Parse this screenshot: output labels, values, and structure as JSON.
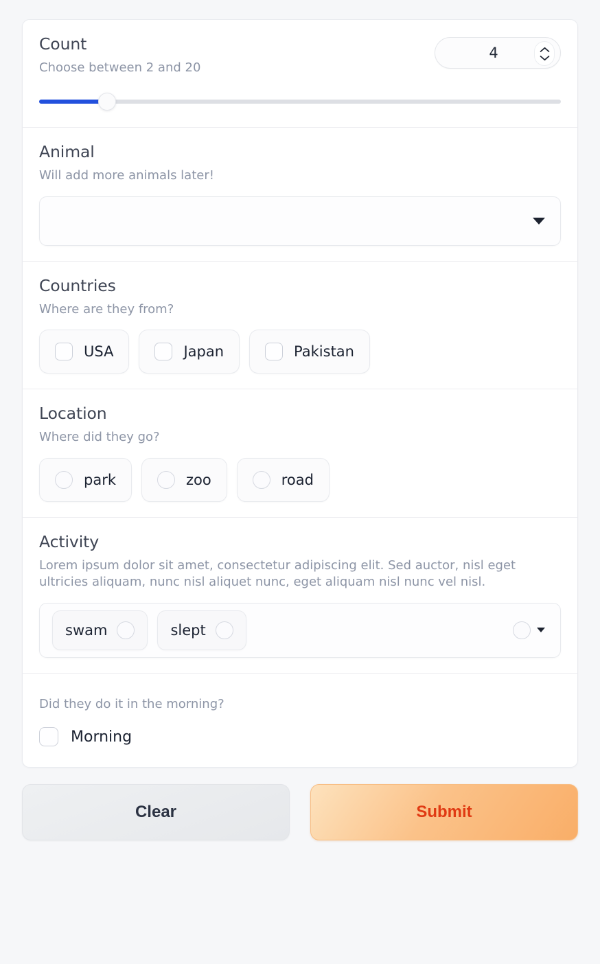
{
  "theme": {
    "page_bg": "#f6f7f9",
    "card_bg": "#ffffff",
    "divider": "#ececf0",
    "title_color": "#3f4554",
    "desc_color": "#8d95a6",
    "slider_fill": "#2250dd",
    "slider_track": "#dddfe4",
    "submit_text": "#e03a13",
    "submit_gradient_from": "#fde2bd",
    "submit_gradient_to": "#f9ae68",
    "clear_text": "#2b3242"
  },
  "count": {
    "title": "Count",
    "description": "Choose between 2 and 20",
    "value": "4",
    "min": 2,
    "max": 20,
    "slider_percent": 13,
    "increment_icon": "chevron-up-icon",
    "decrement_icon": "chevron-down-icon"
  },
  "animal": {
    "title": "Animal",
    "description": "Will add more animals later!",
    "selected": "",
    "placeholder": "",
    "dropdown_icon": "triangle-down-icon"
  },
  "countries": {
    "title": "Countries",
    "description": "Where are they from?",
    "options": [
      {
        "label": "USA",
        "checked": false
      },
      {
        "label": "Japan",
        "checked": false
      },
      {
        "label": "Pakistan",
        "checked": false
      }
    ]
  },
  "location": {
    "title": "Location",
    "description": "Where did they go?",
    "options": [
      {
        "label": "park",
        "selected": false
      },
      {
        "label": "zoo",
        "selected": false
      },
      {
        "label": "road",
        "selected": false
      }
    ]
  },
  "activity": {
    "title": "Activity",
    "description": "Lorem ipsum dolor sit amet, consectetur adipiscing elit. Sed auctor, nisl eget ultricies aliquam, nunc nisl aliquet nunc, eget aliquam nisl nunc vel nisl.",
    "options": [
      {
        "label": "swam",
        "selected": false
      },
      {
        "label": "slept",
        "selected": false
      }
    ],
    "more": {
      "selected": false,
      "dropdown_icon": "triangle-down-icon"
    }
  },
  "morning": {
    "description": "Did they do it in the morning?",
    "label": "Morning",
    "checked": false
  },
  "footer": {
    "clear_label": "Clear",
    "submit_label": "Submit"
  }
}
